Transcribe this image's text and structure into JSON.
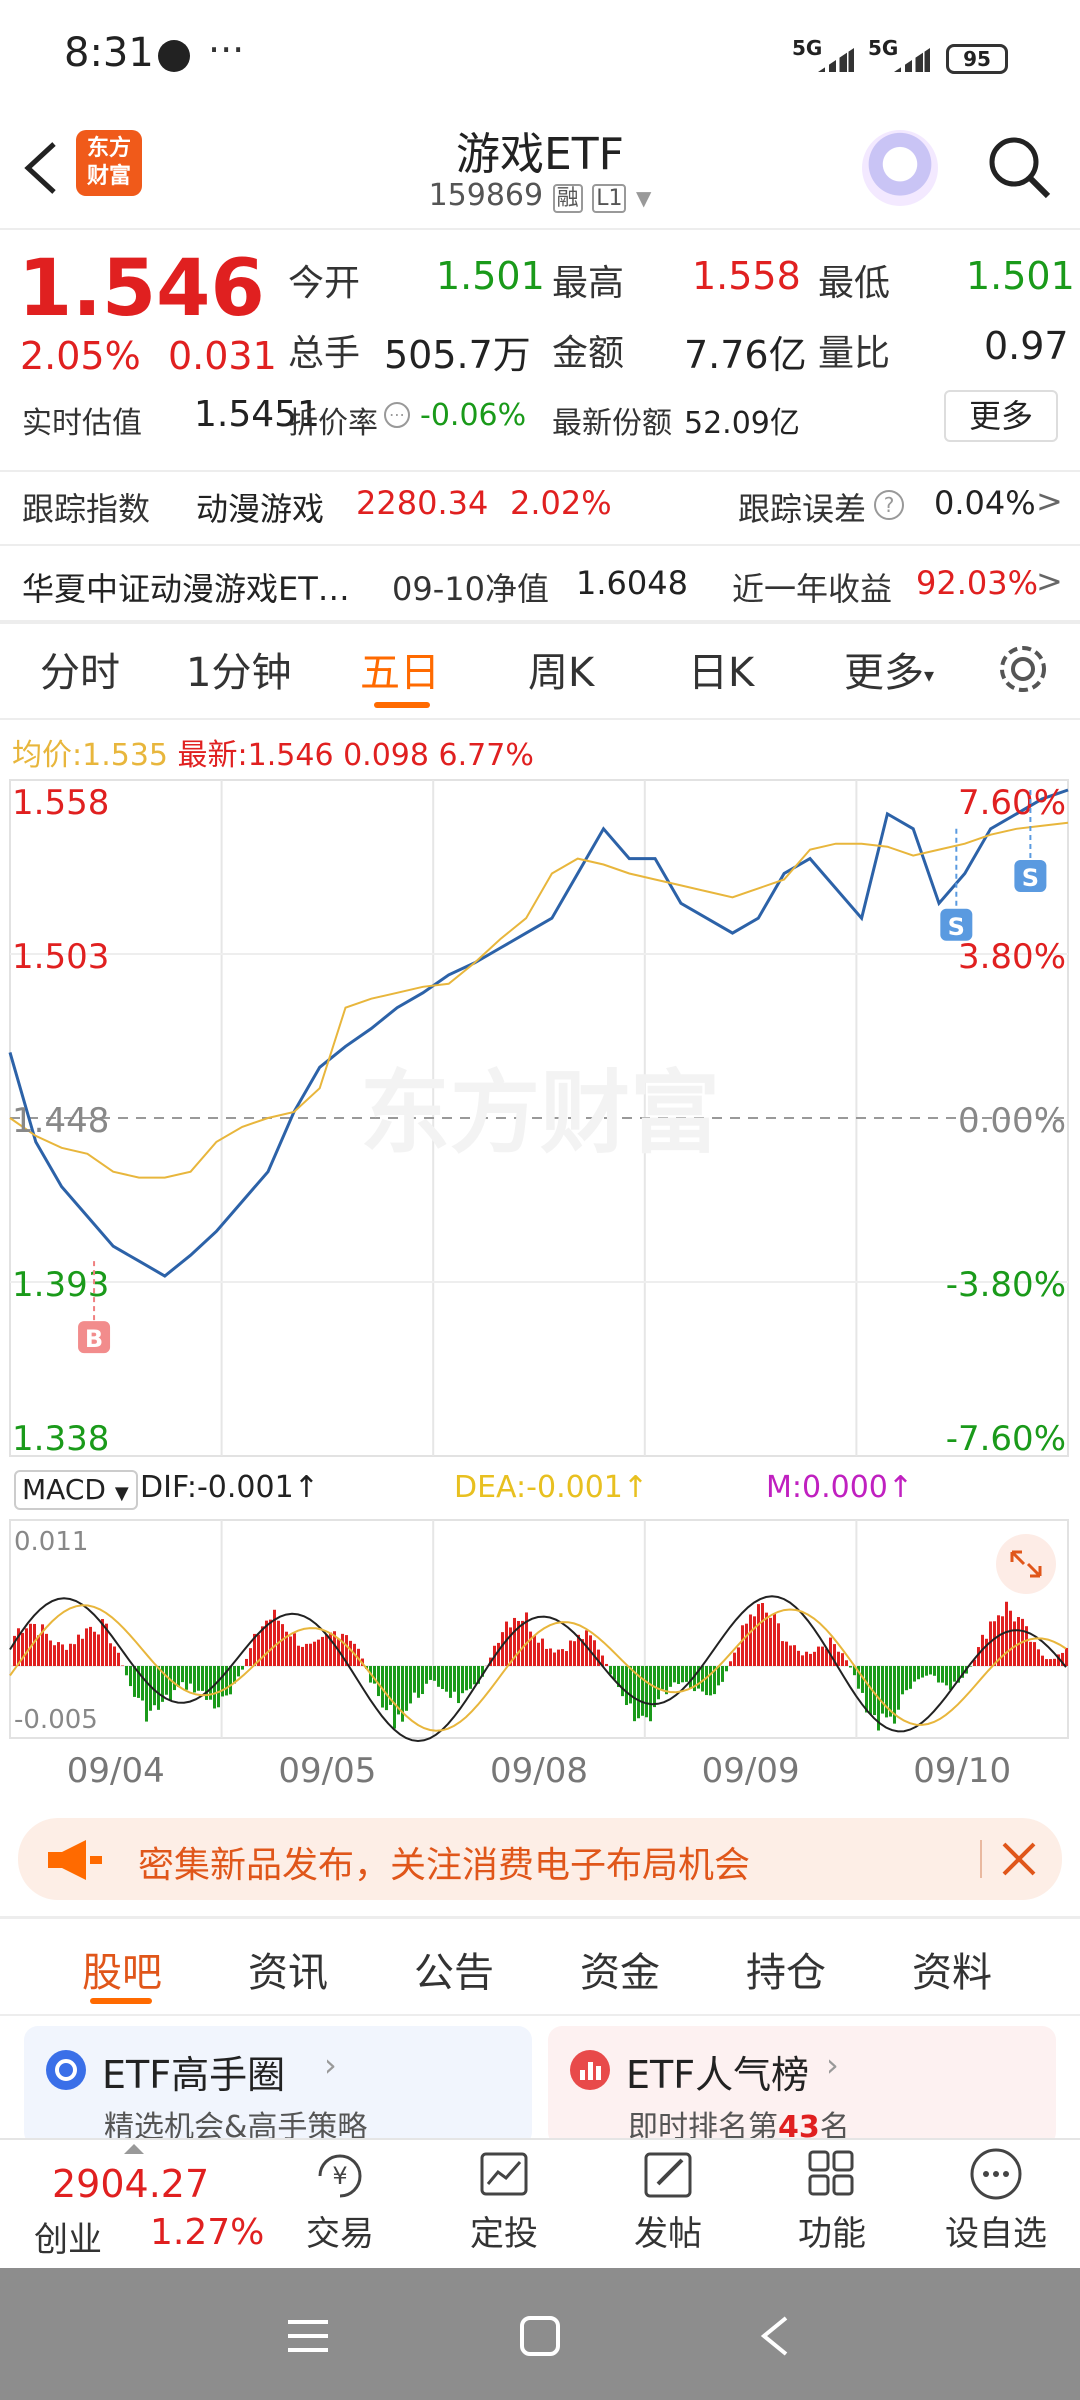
{
  "status": {
    "time": "8:31",
    "dots": "···",
    "net1": "5G",
    "net2": "5G",
    "battery": "95"
  },
  "header": {
    "title": "游戏ETF",
    "code": "159869",
    "tag_rong": "融",
    "tag_level": "L1",
    "logo_text": "东方\n财富"
  },
  "quote": {
    "price": "1.546",
    "pct": "2.05%",
    "change": "0.031",
    "open_label": "今开",
    "open": "1.501",
    "high_label": "最高",
    "high": "1.558",
    "low_label": "最低",
    "low": "1.501",
    "vol_label": "总手",
    "vol": "505.7万",
    "amt_label": "金额",
    "amt": "7.76亿",
    "ratio_label": "量比",
    "ratio": "0.97",
    "iopv_label": "实时估值",
    "iopv": "1.5451",
    "discount_label": "折价率",
    "discount": "-0.06%",
    "shares_label": "最新份额",
    "shares": "52.09亿",
    "more_button": "更多"
  },
  "tracking": {
    "label": "跟踪指数",
    "index_name": "动漫游戏",
    "index_value": "2280.34",
    "index_pct": "2.02%",
    "error_label": "跟踪误差",
    "error_value": "0.04%"
  },
  "fund": {
    "name": "华夏中证动漫游戏ET…",
    "nav_label": "09-10净值",
    "nav": "1.6048",
    "year_label": "近一年收益",
    "year": "92.03%"
  },
  "chart_tabs": [
    "分时",
    "1分钟",
    "五日",
    "周K",
    "日K",
    "更多"
  ],
  "chart_info": {
    "avg_label": "均价:",
    "avg": "1.535",
    "last_label": "最新:",
    "last": "1.546",
    "chg": "0.098",
    "pct": "6.77%"
  },
  "chart_data": {
    "type": "line",
    "y_left_ticks": [
      "1.558",
      "1.503",
      "1.448",
      "1.393",
      "1.338"
    ],
    "y_right_ticks": [
      "7.60%",
      "3.80%",
      "0.00%",
      "-3.80%",
      "-7.60%"
    ],
    "ylim": [
      1.338,
      1.558
    ],
    "x_labels": [
      "09/04",
      "09/05",
      "09/08",
      "09/09",
      "09/10"
    ],
    "watermark": "东方财富",
    "markers": [
      {
        "label": "B",
        "day": 0
      },
      {
        "label": "S",
        "day": 4
      },
      {
        "label": "S",
        "day": 4
      }
    ],
    "series": [
      {
        "name": "price",
        "color": "#2c62a8",
        "values": [
          1.47,
          1.44,
          1.425,
          1.415,
          1.405,
          1.4,
          1.395,
          1.402,
          1.41,
          1.42,
          1.43,
          1.45,
          1.465,
          1.472,
          1.478,
          1.485,
          1.49,
          1.496,
          1.5,
          1.505,
          1.51,
          1.515,
          1.53,
          1.545,
          1.535,
          1.535,
          1.52,
          1.515,
          1.51,
          1.515,
          1.53,
          1.535,
          1.525,
          1.515,
          1.55,
          1.545,
          1.52,
          1.53,
          1.545,
          1.55,
          1.555,
          1.558
        ]
      },
      {
        "name": "avg",
        "color": "#e8b63c",
        "values": [
          1.448,
          1.442,
          1.438,
          1.436,
          1.43,
          1.428,
          1.428,
          1.43,
          1.44,
          1.445,
          1.448,
          1.45,
          1.458,
          1.485,
          1.488,
          1.49,
          1.492,
          1.493,
          1.5,
          1.508,
          1.515,
          1.53,
          1.535,
          1.533,
          1.53,
          1.528,
          1.526,
          1.524,
          1.522,
          1.525,
          1.528,
          1.538,
          1.54,
          1.54,
          1.539,
          1.536,
          1.538,
          1.54,
          1.543,
          1.545,
          1.546,
          1.547
        ]
      }
    ]
  },
  "macd": {
    "label": "MACD",
    "dif_label": "DIF:",
    "dif": "-0.001↑",
    "dea_label": "DEA:",
    "dea": "-0.001↑",
    "m_label": "M:",
    "m": "0.000↑",
    "top": "0.011",
    "bottom": "-0.005"
  },
  "notice": {
    "text": "密集新品发布，关注消费电子布局机会"
  },
  "content_tabs": [
    "股吧",
    "资讯",
    "公告",
    "资金",
    "持仓",
    "资料"
  ],
  "cards": [
    {
      "title": "ETF高手圈",
      "sub": "精选机会&高手策略"
    },
    {
      "title": "ETF人气榜",
      "sub_prefix": "即时排名第",
      "sub_rank": "43",
      "sub_suffix": "名"
    }
  ],
  "bottom_nav": {
    "index_value": "2904.27",
    "index_name": "创业",
    "index_pct": "1.27%",
    "items": [
      "交易",
      "定投",
      "发帖",
      "功能",
      "设自选"
    ]
  },
  "colors": {
    "red": "#e02020",
    "green": "#1a9a1a",
    "orange": "#ff6a00",
    "line": "#2c62a8",
    "avg": "#e8b63c"
  }
}
